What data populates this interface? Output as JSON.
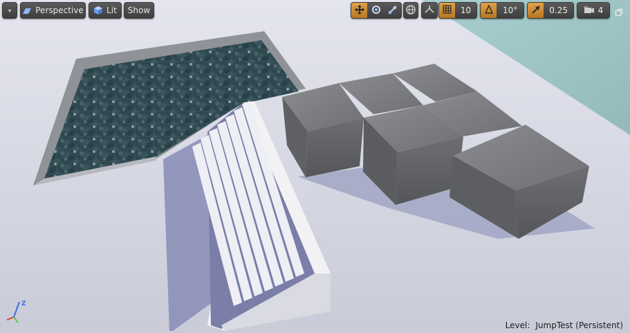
{
  "toolbar": {
    "menu_caret": "▾",
    "perspective_label": "Perspective",
    "lit_label": "Lit",
    "show_label": "Show",
    "grid_snap_value": "10",
    "rotation_snap_value": "10°",
    "scale_snap_value": "0.25",
    "camera_speed_value": "4"
  },
  "status": {
    "level_key": "Level:",
    "level_value": "JumpTest (Persistent)"
  },
  "gizmo": {
    "z": "Z",
    "x_color": "#e23b3b",
    "y_color": "#5fc24a",
    "z_color": "#3b6ee2"
  },
  "colors": {
    "accent_orange": "#d89a3e",
    "toolbar_bg": "#4a4a4a"
  }
}
